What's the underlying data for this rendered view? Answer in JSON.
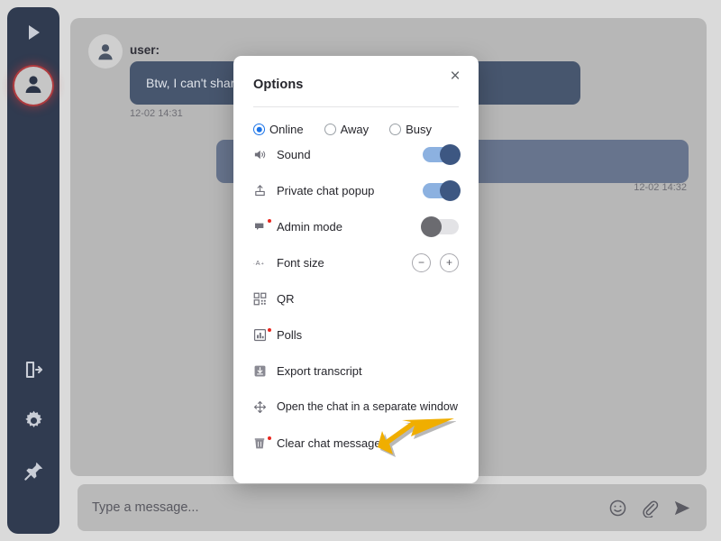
{
  "sidebar": {
    "items": [
      {
        "name": "play-button",
        "icon": "play-icon",
        "label": "Play"
      },
      {
        "name": "user-avatar",
        "icon": "person-icon",
        "label": "User"
      },
      {
        "name": "logout-button",
        "icon": "exit-door-icon",
        "label": "Log out"
      },
      {
        "name": "settings-button",
        "icon": "gear-icon",
        "label": "Settings"
      },
      {
        "name": "pin-button",
        "icon": "pushpin-icon",
        "label": "Pin"
      }
    ]
  },
  "chat": {
    "incoming": {
      "username": "user:",
      "text": "Btw, I can't share my screen, it's disabled!",
      "timestamp": "12-02 14:31"
    },
    "outgoing": {
      "text": "",
      "timestamp": "12-02 14:32"
    }
  },
  "composer": {
    "placeholder": "Type a message...",
    "value": "",
    "icons": [
      "emoji-icon",
      "attachment-icon",
      "send-icon"
    ]
  },
  "modal": {
    "title": "Options",
    "close_label": "×",
    "status": {
      "selected": "Online",
      "options": [
        {
          "label": "Online",
          "selected": true
        },
        {
          "label": "Away",
          "selected": false
        },
        {
          "label": "Busy",
          "selected": false
        }
      ]
    },
    "items": [
      {
        "label": "Sound",
        "icon": "speaker-icon",
        "control": "toggle",
        "state": "on",
        "badge": false
      },
      {
        "label": "Private chat popup",
        "icon": "popup-upload-icon",
        "control": "toggle",
        "state": "on",
        "badge": false
      },
      {
        "label": "Admin mode",
        "icon": "flag-icon",
        "control": "toggle",
        "state": "off",
        "badge": true
      },
      {
        "label": "Font size",
        "icon": "font-size-icon",
        "control": "stepper",
        "minus_label": "−",
        "plus_label": "+",
        "badge": false
      },
      {
        "label": "QR",
        "icon": "qr-code-icon",
        "control": "none",
        "badge": false
      },
      {
        "label": "Polls",
        "icon": "bar-chart-icon",
        "control": "none",
        "badge": true
      },
      {
        "label": "Export transcript",
        "icon": "download-icon",
        "control": "none",
        "badge": false
      },
      {
        "label": "Open the chat in a separate window",
        "icon": "move-arrows-icon",
        "control": "none",
        "badge": false
      },
      {
        "label": "Clear chat messages",
        "icon": "trash-icon",
        "control": "none",
        "badge": true
      }
    ]
  },
  "annotation": {
    "type": "arrow",
    "color": "#f0ae00",
    "points_to": "Clear chat messages"
  },
  "colors": {
    "sidebar_bg": "#303b50",
    "page_bg": "#dadada",
    "chat_panel_bg": "#b7b7b7",
    "bubble_incoming": "#47566e",
    "bubble_outgoing": "#67748d",
    "accent_blue": "#1a73e8",
    "toggle_on_track": "#8cb1e0",
    "toggle_on_knob": "#3d5782",
    "badge_red": "#e8271f",
    "arrow_yellow": "#f0ae00"
  }
}
